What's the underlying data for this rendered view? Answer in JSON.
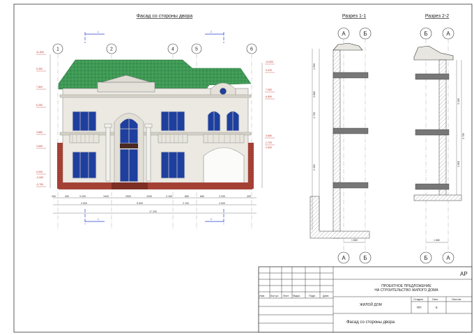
{
  "titles": {
    "facade": "Фасад со стороны двора",
    "section1": "Разрез 1-1",
    "section2": "Разрез 2-2"
  },
  "axes_facade": [
    "1",
    "2",
    "4",
    "5",
    "6"
  ],
  "axes_section1_top": [
    "А",
    "Б"
  ],
  "axes_section1_bottom": [
    "А",
    "Б"
  ],
  "axes_section2_top": [
    "Б",
    "А"
  ],
  "axes_section2_bottom": [
    "Б",
    "А"
  ],
  "section_marks": {
    "cut1": "1",
    "cut2": "2"
  },
  "levels_left": [
    "11.800",
    "9.450",
    "7.800",
    "6.250",
    "3.880",
    "2.650",
    "0.000",
    "-0.050",
    "-0.750"
  ],
  "levels_right": [
    "10.800",
    "9.200",
    "7.060",
    "6.650",
    "3.680",
    "2.700",
    "2.690"
  ],
  "dims_bottom_row1": [
    "400",
    "400",
    "3 200",
    "1940",
    "2500",
    "1940",
    "3 160",
    "680",
    "680",
    "3 200",
    "400"
  ],
  "dims_bottom_row2": [
    "4 000",
    "5 600",
    "2 100",
    "4 000"
  ],
  "dims_bottom_total": "17 200",
  "section1_dims": [
    "1 950",
    "3 880",
    "2 700",
    "2 450",
    "1 880"
  ],
  "section2_dims": [
    "3 180",
    "3 850",
    "3 750",
    "1 880"
  ],
  "section_bottom_dim": "1 880",
  "title_block": {
    "code": "АР",
    "project_title": "ПРОЕКТНОЕ ПРЕДЛОЖЕНИЕ НА СТРОИТЕЛЬСТВО ЖИЛОГО ДОМА",
    "project_line1": "ПРОЕКТНОЕ ПРЕДЛОЖЕНИЕ",
    "project_line2": "НА СТРОИТЕЛЬСТВО ЖИЛОГО ДОМА",
    "object": "ЖИЛОЙ ДОМ",
    "sheet_name": "Фасад со стороны двора",
    "col_headers": [
      "Изм.",
      "Кол.уч.",
      "Лист",
      "№док.",
      "Подп.",
      "Дата"
    ],
    "stage_label": "Стадия",
    "sheet_label": "Лист",
    "sheets_label": "Листов",
    "stage": "ПП",
    "sheet": "6",
    "sheets": ""
  },
  "colors": {
    "roof": "#3f9a56",
    "wall": "#ebe9e2",
    "window": "#1e3f9e",
    "plinth": "#b5483a",
    "level_mark": "#c0392b",
    "axis_line": "#2a3fd0"
  }
}
